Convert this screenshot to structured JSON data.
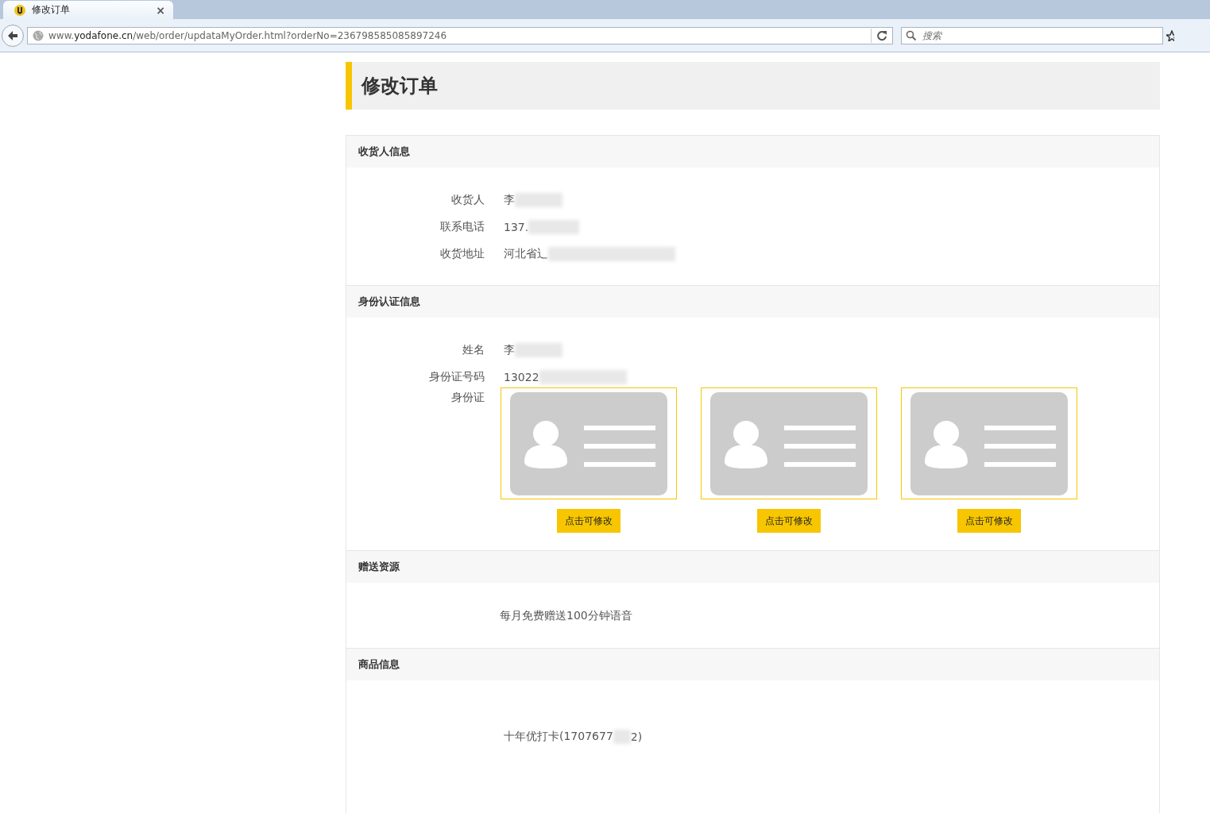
{
  "browser": {
    "tab_title": "修改订单",
    "tab_close": "×",
    "url_prefix": "www.",
    "url_host": "yodafone.cn",
    "url_path": "/web/order/updataMyOrder.html?orderNo=236798585085897246",
    "search_placeholder": "搜索"
  },
  "page_title": "修改订单",
  "sections": [
    {
      "kind": "fields",
      "title": "收货人信息",
      "fields": [
        {
          "label": "收货人",
          "value": "李"
        },
        {
          "label": "联系电话",
          "value": "137."
        },
        {
          "label": "收货地址",
          "value": "河北省辶"
        }
      ]
    },
    {
      "kind": "identity",
      "title": "身份认证信息",
      "fields": [
        {
          "label": "姓名",
          "value": "李"
        },
        {
          "label": "身份证号码",
          "value": "13022"
        }
      ],
      "photo_label": "身份证",
      "photos": [
        {
          "button": "点击可修改"
        },
        {
          "button": "点击可修改"
        },
        {
          "button": "点击可修改"
        }
      ]
    },
    {
      "kind": "text",
      "title": "赠送资源",
      "text": "每月免费赠送100分钟语音"
    },
    {
      "kind": "product",
      "title": "商品信息",
      "text": "十年优打卡(1707677",
      "tail": "2)"
    }
  ]
}
